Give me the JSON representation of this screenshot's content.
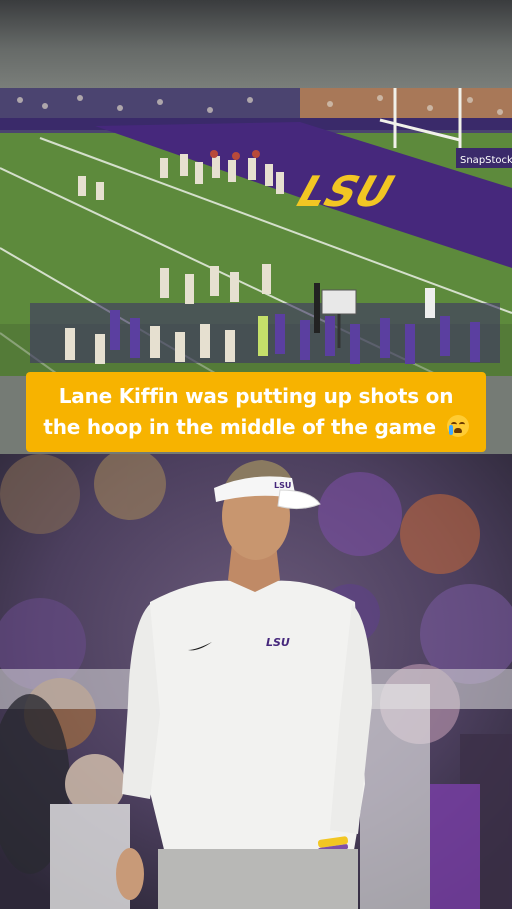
{
  "caption": {
    "line1": "Lane Kiffin was putting up shots on",
    "line2": "the hoop in the middle of the game",
    "emoji": "loudly-crying-face-emoji"
  },
  "field_photo": {
    "endzone_text": "LSU",
    "sign_text": "SnapStockiot"
  },
  "coach_photo": {
    "visor_logo": "LSU",
    "shirt_logo": "LSU"
  },
  "colors": {
    "caption_bg": "#f7b300",
    "lsu_purple": "#46287c",
    "lsu_gold": "#f2c623",
    "turf": "#5d8a3c"
  }
}
